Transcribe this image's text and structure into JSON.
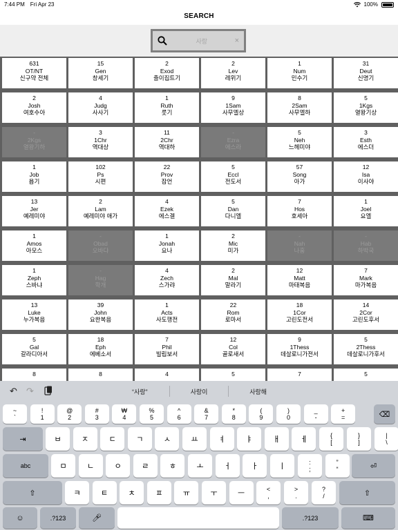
{
  "status": {
    "time": "7:44 PM",
    "date": "Fri Apr 23",
    "battery": "100%"
  },
  "nav": {
    "title": "SEARCH"
  },
  "search": {
    "placeholder": "사랑",
    "clear": "×"
  },
  "grid": [
    {
      "c": "631",
      "a": "OT/NT",
      "k": "신구약 전체",
      "on": true
    },
    {
      "c": "15",
      "a": "Gen",
      "k": "창세기",
      "on": true
    },
    {
      "c": "2",
      "a": "Exod",
      "k": "출이집트기",
      "on": true
    },
    {
      "c": "2",
      "a": "Lev",
      "k": "레위기",
      "on": true
    },
    {
      "c": "1",
      "a": "Num",
      "k": "민수기",
      "on": true
    },
    {
      "c": "31",
      "a": "Deut",
      "k": "신명기",
      "on": true
    },
    {
      "c": "2",
      "a": "Josh",
      "k": "여호수아",
      "on": true
    },
    {
      "c": "4",
      "a": "Judg",
      "k": "사사기",
      "on": true
    },
    {
      "c": "1",
      "a": "Ruth",
      "k": "룻기",
      "on": true
    },
    {
      "c": "9",
      "a": "1Sam",
      "k": "사무엘상",
      "on": true
    },
    {
      "c": "8",
      "a": "2Sam",
      "k": "사무엘하",
      "on": true
    },
    {
      "c": "5",
      "a": "1Kgs",
      "k": "열왕기상",
      "on": true
    },
    {
      "c": "-",
      "a": "2Kgs",
      "k": "열왕기하",
      "on": false
    },
    {
      "c": "3",
      "a": "1Chr",
      "k": "역대상",
      "on": true
    },
    {
      "c": "11",
      "a": "2Chr",
      "k": "역대하",
      "on": true
    },
    {
      "c": "-",
      "a": "Ezra",
      "k": "에스라",
      "on": false
    },
    {
      "c": "5",
      "a": "Neh",
      "k": "느헤미야",
      "on": true
    },
    {
      "c": "3",
      "a": "Esth",
      "k": "에스더",
      "on": true
    },
    {
      "c": "1",
      "a": "Job",
      "k": "욥기",
      "on": true
    },
    {
      "c": "102",
      "a": "Ps",
      "k": "시편",
      "on": true
    },
    {
      "c": "22",
      "a": "Prov",
      "k": "잠언",
      "on": true
    },
    {
      "c": "5",
      "a": "Eccl",
      "k": "전도서",
      "on": true
    },
    {
      "c": "57",
      "a": "Song",
      "k": "아가",
      "on": true
    },
    {
      "c": "12",
      "a": "Isa",
      "k": "이사야",
      "on": true
    },
    {
      "c": "13",
      "a": "Jer",
      "k": "예레미야",
      "on": true
    },
    {
      "c": "2",
      "a": "Lam",
      "k": "예레미야 애가",
      "on": true
    },
    {
      "c": "4",
      "a": "Ezek",
      "k": "에스겔",
      "on": true
    },
    {
      "c": "5",
      "a": "Dan",
      "k": "다니엘",
      "on": true
    },
    {
      "c": "7",
      "a": "Hos",
      "k": "호세아",
      "on": true
    },
    {
      "c": "1",
      "a": "Joel",
      "k": "요엘",
      "on": true
    },
    {
      "c": "1",
      "a": "Amos",
      "k": "아모스",
      "on": true
    },
    {
      "c": "-",
      "a": "Obad",
      "k": "오바댜",
      "on": false
    },
    {
      "c": "1",
      "a": "Jonah",
      "k": "요나",
      "on": true
    },
    {
      "c": "2",
      "a": "Mic",
      "k": "미가",
      "on": true
    },
    {
      "c": "-",
      "a": "Nah",
      "k": "나훔",
      "on": false
    },
    {
      "c": "-",
      "a": "Hab",
      "k": "하박국",
      "on": false
    },
    {
      "c": "1",
      "a": "Zeph",
      "k": "스바냐",
      "on": true
    },
    {
      "c": "-",
      "a": "Hag",
      "k": "학개",
      "on": false
    },
    {
      "c": "4",
      "a": "Zech",
      "k": "스가랴",
      "on": true
    },
    {
      "c": "2",
      "a": "Mal",
      "k": "말라기",
      "on": true
    },
    {
      "c": "12",
      "a": "Matt",
      "k": "마태복음",
      "on": true
    },
    {
      "c": "7",
      "a": "Mark",
      "k": "마가복음",
      "on": true
    },
    {
      "c": "13",
      "a": "Luke",
      "k": "누가복음",
      "on": true
    },
    {
      "c": "39",
      "a": "John",
      "k": "요한복음",
      "on": true
    },
    {
      "c": "1",
      "a": "Acts",
      "k": "사도행전",
      "on": true
    },
    {
      "c": "22",
      "a": "Rom",
      "k": "로마서",
      "on": true
    },
    {
      "c": "18",
      "a": "1Cor",
      "k": "고린도전서",
      "on": true
    },
    {
      "c": "14",
      "a": "2Cor",
      "k": "고린도후서",
      "on": true
    },
    {
      "c": "5",
      "a": "Gal",
      "k": "갈라디아서",
      "on": true
    },
    {
      "c": "18",
      "a": "Eph",
      "k": "에베소서",
      "on": true
    },
    {
      "c": "7",
      "a": "Phil",
      "k": "빌립보서",
      "on": true
    },
    {
      "c": "12",
      "a": "Col",
      "k": "골로새서",
      "on": true
    },
    {
      "c": "9",
      "a": "1Thess",
      "k": "데살로니가전서",
      "on": true
    },
    {
      "c": "5",
      "a": "2Thess",
      "k": "데살로니가후서",
      "on": true
    },
    {
      "c": "8",
      "a": "",
      "k": "",
      "on": true
    },
    {
      "c": "8",
      "a": "",
      "k": "",
      "on": true
    },
    {
      "c": "4",
      "a": "",
      "k": "",
      "on": true
    },
    {
      "c": "5",
      "a": "",
      "k": "",
      "on": true
    },
    {
      "c": "7",
      "a": "",
      "k": "",
      "on": true
    },
    {
      "c": "5",
      "a": "",
      "k": "",
      "on": true
    }
  ],
  "keyboard": {
    "suggestions": [
      "“사랑”",
      "사랑이",
      "사랑해"
    ],
    "row1": [
      [
        "~",
        "`"
      ],
      [
        "!",
        "1"
      ],
      [
        "@",
        "2"
      ],
      [
        "#",
        "3"
      ],
      [
        "₩",
        "4"
      ],
      [
        "%",
        "5"
      ],
      [
        "^",
        "6"
      ],
      [
        "&",
        "7"
      ],
      [
        "*",
        "8"
      ],
      [
        "(",
        "9"
      ],
      [
        ")",
        "0"
      ],
      [
        "_",
        "-"
      ],
      [
        "+",
        "="
      ]
    ],
    "row2": [
      "ㅂ",
      "ㅈ",
      "ㄷ",
      "ㄱ",
      "ㅅ",
      "ㅛ",
      "ㅕ",
      "ㅑ",
      "ㅐ",
      "ㅔ"
    ],
    "row2_punct": [
      [
        "{",
        "["
      ],
      [
        "}",
        "]"
      ],
      [
        "|",
        "\\"
      ]
    ],
    "row3": [
      "ㅁ",
      "ㄴ",
      "ㅇ",
      "ㄹ",
      "ㅎ",
      "ㅗ",
      "ㅓ",
      "ㅏ",
      "ㅣ"
    ],
    "row3_punct": [
      [
        ":",
        ";"
      ],
      [
        "”",
        "“"
      ]
    ],
    "row4": [
      "ㅋ",
      "ㅌ",
      "ㅊ",
      "ㅍ",
      "ㅠ",
      "ㅜ",
      "ㅡ"
    ],
    "row4_punct": [
      [
        "<",
        ","
      ],
      [
        ">",
        "."
      ],
      [
        "?",
        "/"
      ]
    ],
    "tab_label": "⇥",
    "caps_label": "abc",
    "numbers_label": ".?123"
  }
}
